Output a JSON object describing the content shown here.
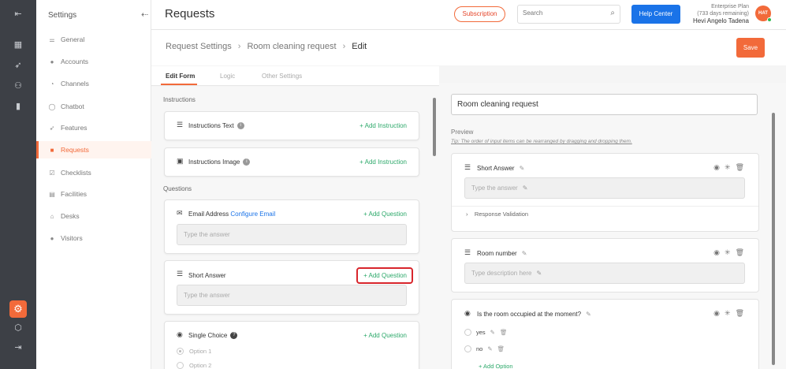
{
  "rail": {
    "icons": [
      "collapse-icon",
      "dashboard-icon",
      "rocket-icon",
      "people-chart-icon",
      "bar-chart-icon",
      "gear-icon",
      "cube-icon",
      "logout-icon"
    ]
  },
  "sidebar": {
    "title": "Settings",
    "items": [
      {
        "label": "General",
        "icon": "sliders-icon"
      },
      {
        "label": "Accounts",
        "icon": "users-icon"
      },
      {
        "label": "Channels",
        "icon": "channels-icon"
      },
      {
        "label": "Chatbot",
        "icon": "chat-icon"
      },
      {
        "label": "Features",
        "icon": "rocket-icon"
      },
      {
        "label": "Requests",
        "icon": "request-icon",
        "active": true
      },
      {
        "label": "Checklists",
        "icon": "checklist-icon"
      },
      {
        "label": "Facilities",
        "icon": "calendar-icon"
      },
      {
        "label": "Desks",
        "icon": "desk-icon"
      },
      {
        "label": "Visitors",
        "icon": "visitors-icon"
      }
    ]
  },
  "header": {
    "title": "Requests",
    "subscription_label": "Subscription",
    "search_placeholder": "Search",
    "help_label": "Help Center",
    "plan_name": "Enterprise Plan",
    "plan_days": "(733 days remaining)",
    "user_name": "Hevi Angelo Tadena",
    "avatar_initials": "HAT"
  },
  "breadcrumb": {
    "items": [
      "Request Settings",
      "Room cleaning request",
      "Edit"
    ],
    "save_label": "Save"
  },
  "tabs": [
    "Edit Form",
    "Logic",
    "Other Settings"
  ],
  "left": {
    "instructions_label": "Instructions",
    "questions_label": "Questions",
    "instruction_cards": [
      {
        "title": "Instructions Text",
        "action": "+ Add Instruction"
      },
      {
        "title": "Instructions Image",
        "action": "+ Add Instruction"
      }
    ],
    "email_card": {
      "title": "Email Address",
      "link": "Configure Email",
      "action": "+ Add Question",
      "placeholder": "Type the answer"
    },
    "short_card": {
      "title": "Short Answer",
      "action": "+ Add Question",
      "placeholder": "Type the answer"
    },
    "choice_card": {
      "title": "Single Choice",
      "action": "+ Add Question",
      "options": [
        "Option 1",
        "Option 2"
      ]
    }
  },
  "right": {
    "request_title_value": "Room cleaning request",
    "preview_label": "Preview",
    "tip": "Tip: The order of input items can be rearranged by dragging and dropping them.",
    "q1": {
      "title": "Short Answer",
      "placeholder": "Type the answer",
      "validation": "Response Validation"
    },
    "q2": {
      "title": "Room number",
      "placeholder": "Type description here"
    },
    "q3": {
      "title": "Is the room occupied at the moment?",
      "options": [
        "yes",
        "no"
      ],
      "add_option": "+ Add Option"
    }
  }
}
